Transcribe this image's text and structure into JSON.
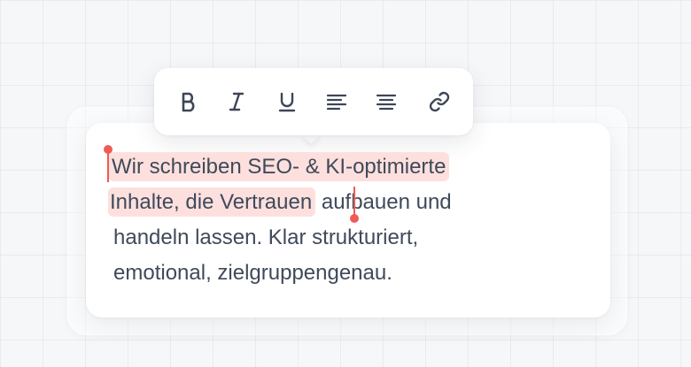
{
  "toolbar": {
    "buttons": [
      {
        "name": "bold",
        "icon": "bold-icon",
        "glyph": "B"
      },
      {
        "name": "italic",
        "icon": "italic-icon",
        "glyph": "I"
      },
      {
        "name": "underline",
        "icon": "underline-icon",
        "glyph": "U"
      },
      {
        "name": "align-left",
        "icon": "align-left-icon"
      },
      {
        "name": "align-center",
        "icon": "align-center-icon"
      },
      {
        "name": "link",
        "icon": "link-icon"
      }
    ]
  },
  "editor": {
    "line1_selected": "Wir schreiben SEO- & KI-optimierte",
    "line2_selected": "Inhalte, die Vertrauen",
    "line2_rest": " aufbauen und",
    "line3": "handeln lassen. Klar strukturiert,",
    "line4": "emotional, zielgruppengenau."
  },
  "colors": {
    "text": "#3f4a5a",
    "selection_bg": "#fde0de",
    "caret": "#ef5b55",
    "icon": "#3c4656"
  }
}
